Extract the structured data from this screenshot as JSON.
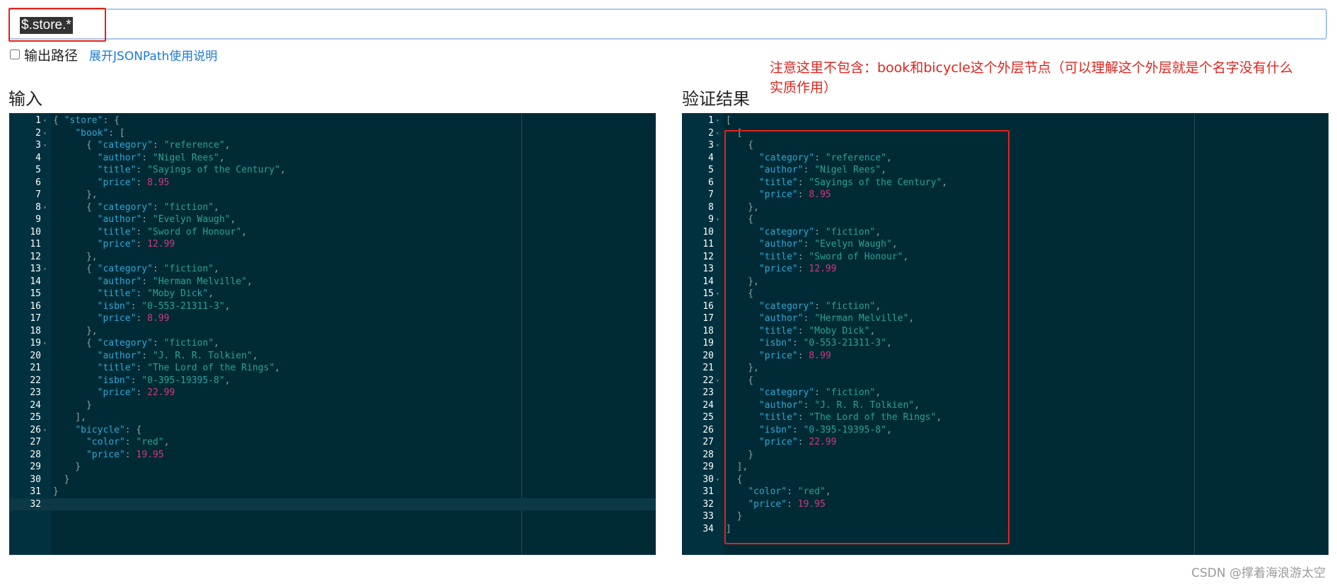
{
  "query": {
    "value": "$.store.*"
  },
  "options": {
    "output_path_label": "输出路径",
    "output_path_checked": false,
    "help_link": "展开JSONPath使用说明"
  },
  "titles": {
    "input": "输入",
    "result": "验证结果"
  },
  "note": "注意这里不包含：book和bicycle这个外层节点（可以理解这个外层就是个名字没有什么实质作用）",
  "watermark": "CSDN @撑着海浪游太空",
  "input_editor": {
    "active_line": 32,
    "lines": [
      {
        "n": "1",
        "fold": true,
        "t": [
          [
            "p",
            "{ "
          ],
          [
            "k",
            "\"store\""
          ],
          [
            "p",
            ": {"
          ]
        ]
      },
      {
        "n": "2",
        "fold": true,
        "t": [
          [
            "p",
            "    "
          ],
          [
            "k",
            "\"book\""
          ],
          [
            "p",
            ": ["
          ]
        ]
      },
      {
        "n": "3",
        "fold": true,
        "t": [
          [
            "p",
            "      { "
          ],
          [
            "k",
            "\"category\""
          ],
          [
            "p",
            ": "
          ],
          [
            "s",
            "\"reference\""
          ],
          [
            "p",
            ","
          ]
        ]
      },
      {
        "n": "4",
        "t": [
          [
            "p",
            "        "
          ],
          [
            "k",
            "\"author\""
          ],
          [
            "p",
            ": "
          ],
          [
            "s",
            "\"Nigel Rees\""
          ],
          [
            "p",
            ","
          ]
        ]
      },
      {
        "n": "5",
        "t": [
          [
            "p",
            "        "
          ],
          [
            "k",
            "\"title\""
          ],
          [
            "p",
            ": "
          ],
          [
            "s",
            "\"Sayings of the Century\""
          ],
          [
            "p",
            ","
          ]
        ]
      },
      {
        "n": "6",
        "t": [
          [
            "p",
            "        "
          ],
          [
            "k",
            "\"price\""
          ],
          [
            "p",
            ": "
          ],
          [
            "n",
            "8.95"
          ]
        ]
      },
      {
        "n": "7",
        "t": [
          [
            "p",
            "      },"
          ]
        ]
      },
      {
        "n": "8",
        "fold": true,
        "t": [
          [
            "p",
            "      { "
          ],
          [
            "k",
            "\"category\""
          ],
          [
            "p",
            ": "
          ],
          [
            "s",
            "\"fiction\""
          ],
          [
            "p",
            ","
          ]
        ]
      },
      {
        "n": "9",
        "t": [
          [
            "p",
            "        "
          ],
          [
            "k",
            "\"author\""
          ],
          [
            "p",
            ": "
          ],
          [
            "s",
            "\"Evelyn Waugh\""
          ],
          [
            "p",
            ","
          ]
        ]
      },
      {
        "n": "10",
        "t": [
          [
            "p",
            "        "
          ],
          [
            "k",
            "\"title\""
          ],
          [
            "p",
            ": "
          ],
          [
            "s",
            "\"Sword of Honour\""
          ],
          [
            "p",
            ","
          ]
        ]
      },
      {
        "n": "11",
        "t": [
          [
            "p",
            "        "
          ],
          [
            "k",
            "\"price\""
          ],
          [
            "p",
            ": "
          ],
          [
            "n",
            "12.99"
          ]
        ]
      },
      {
        "n": "12",
        "t": [
          [
            "p",
            "      },"
          ]
        ]
      },
      {
        "n": "13",
        "fold": true,
        "t": [
          [
            "p",
            "      { "
          ],
          [
            "k",
            "\"category\""
          ],
          [
            "p",
            ": "
          ],
          [
            "s",
            "\"fiction\""
          ],
          [
            "p",
            ","
          ]
        ]
      },
      {
        "n": "14",
        "t": [
          [
            "p",
            "        "
          ],
          [
            "k",
            "\"author\""
          ],
          [
            "p",
            ": "
          ],
          [
            "s",
            "\"Herman Melville\""
          ],
          [
            "p",
            ","
          ]
        ]
      },
      {
        "n": "15",
        "t": [
          [
            "p",
            "        "
          ],
          [
            "k",
            "\"title\""
          ],
          [
            "p",
            ": "
          ],
          [
            "s",
            "\"Moby Dick\""
          ],
          [
            "p",
            ","
          ]
        ]
      },
      {
        "n": "16",
        "t": [
          [
            "p",
            "        "
          ],
          [
            "k",
            "\"isbn\""
          ],
          [
            "p",
            ": "
          ],
          [
            "s",
            "\"0-553-21311-3\""
          ],
          [
            "p",
            ","
          ]
        ]
      },
      {
        "n": "17",
        "t": [
          [
            "p",
            "        "
          ],
          [
            "k",
            "\"price\""
          ],
          [
            "p",
            ": "
          ],
          [
            "n",
            "8.99"
          ]
        ]
      },
      {
        "n": "18",
        "t": [
          [
            "p",
            "      },"
          ]
        ]
      },
      {
        "n": "19",
        "fold": true,
        "t": [
          [
            "p",
            "      { "
          ],
          [
            "k",
            "\"category\""
          ],
          [
            "p",
            ": "
          ],
          [
            "s",
            "\"fiction\""
          ],
          [
            "p",
            ","
          ]
        ]
      },
      {
        "n": "20",
        "t": [
          [
            "p",
            "        "
          ],
          [
            "k",
            "\"author\""
          ],
          [
            "p",
            ": "
          ],
          [
            "s",
            "\"J. R. R. Tolkien\""
          ],
          [
            "p",
            ","
          ]
        ]
      },
      {
        "n": "21",
        "t": [
          [
            "p",
            "        "
          ],
          [
            "k",
            "\"title\""
          ],
          [
            "p",
            ": "
          ],
          [
            "s",
            "\"The Lord of the Rings\""
          ],
          [
            "p",
            ","
          ]
        ]
      },
      {
        "n": "22",
        "t": [
          [
            "p",
            "        "
          ],
          [
            "k",
            "\"isbn\""
          ],
          [
            "p",
            ": "
          ],
          [
            "s",
            "\"0-395-19395-8\""
          ],
          [
            "p",
            ","
          ]
        ]
      },
      {
        "n": "23",
        "t": [
          [
            "p",
            "        "
          ],
          [
            "k",
            "\"price\""
          ],
          [
            "p",
            ": "
          ],
          [
            "n",
            "22.99"
          ]
        ]
      },
      {
        "n": "24",
        "t": [
          [
            "p",
            "      }"
          ]
        ]
      },
      {
        "n": "25",
        "t": [
          [
            "p",
            "    ],"
          ]
        ]
      },
      {
        "n": "26",
        "fold": true,
        "t": [
          [
            "p",
            "    "
          ],
          [
            "k",
            "\"bicycle\""
          ],
          [
            "p",
            ": {"
          ]
        ]
      },
      {
        "n": "27",
        "t": [
          [
            "p",
            "      "
          ],
          [
            "k",
            "\"color\""
          ],
          [
            "p",
            ": "
          ],
          [
            "s",
            "\"red\""
          ],
          [
            "p",
            ","
          ]
        ]
      },
      {
        "n": "28",
        "t": [
          [
            "p",
            "      "
          ],
          [
            "k",
            "\"price\""
          ],
          [
            "p",
            ": "
          ],
          [
            "n",
            "19.95"
          ]
        ]
      },
      {
        "n": "29",
        "t": [
          [
            "p",
            "    }"
          ]
        ]
      },
      {
        "n": "30",
        "t": [
          [
            "p",
            "  }"
          ]
        ]
      },
      {
        "n": "31",
        "t": [
          [
            "p",
            "}"
          ]
        ]
      },
      {
        "n": "32",
        "t": [
          [
            "p",
            ""
          ]
        ]
      }
    ]
  },
  "result_editor": {
    "active_line": 0,
    "lines": [
      {
        "n": "1",
        "fold": true,
        "t": [
          [
            "p",
            "["
          ]
        ]
      },
      {
        "n": "2",
        "fold": true,
        "t": [
          [
            "p",
            "  ["
          ]
        ]
      },
      {
        "n": "3",
        "fold": true,
        "t": [
          [
            "p",
            "    {"
          ]
        ]
      },
      {
        "n": "4",
        "t": [
          [
            "p",
            "      "
          ],
          [
            "k",
            "\"category\""
          ],
          [
            "p",
            ": "
          ],
          [
            "s",
            "\"reference\""
          ],
          [
            "p",
            ","
          ]
        ]
      },
      {
        "n": "5",
        "t": [
          [
            "p",
            "      "
          ],
          [
            "k",
            "\"author\""
          ],
          [
            "p",
            ": "
          ],
          [
            "s",
            "\"Nigel Rees\""
          ],
          [
            "p",
            ","
          ]
        ]
      },
      {
        "n": "6",
        "t": [
          [
            "p",
            "      "
          ],
          [
            "k",
            "\"title\""
          ],
          [
            "p",
            ": "
          ],
          [
            "s",
            "\"Sayings of the Century\""
          ],
          [
            "p",
            ","
          ]
        ]
      },
      {
        "n": "7",
        "t": [
          [
            "p",
            "      "
          ],
          [
            "k",
            "\"price\""
          ],
          [
            "p",
            ": "
          ],
          [
            "n",
            "8.95"
          ]
        ]
      },
      {
        "n": "8",
        "t": [
          [
            "p",
            "    },"
          ]
        ]
      },
      {
        "n": "9",
        "fold": true,
        "t": [
          [
            "p",
            "    {"
          ]
        ]
      },
      {
        "n": "10",
        "t": [
          [
            "p",
            "      "
          ],
          [
            "k",
            "\"category\""
          ],
          [
            "p",
            ": "
          ],
          [
            "s",
            "\"fiction\""
          ],
          [
            "p",
            ","
          ]
        ]
      },
      {
        "n": "11",
        "t": [
          [
            "p",
            "      "
          ],
          [
            "k",
            "\"author\""
          ],
          [
            "p",
            ": "
          ],
          [
            "s",
            "\"Evelyn Waugh\""
          ],
          [
            "p",
            ","
          ]
        ]
      },
      {
        "n": "12",
        "t": [
          [
            "p",
            "      "
          ],
          [
            "k",
            "\"title\""
          ],
          [
            "p",
            ": "
          ],
          [
            "s",
            "\"Sword of Honour\""
          ],
          [
            "p",
            ","
          ]
        ]
      },
      {
        "n": "13",
        "t": [
          [
            "p",
            "      "
          ],
          [
            "k",
            "\"price\""
          ],
          [
            "p",
            ": "
          ],
          [
            "n",
            "12.99"
          ]
        ]
      },
      {
        "n": "14",
        "t": [
          [
            "p",
            "    },"
          ]
        ]
      },
      {
        "n": "15",
        "fold": true,
        "t": [
          [
            "p",
            "    {"
          ]
        ]
      },
      {
        "n": "16",
        "t": [
          [
            "p",
            "      "
          ],
          [
            "k",
            "\"category\""
          ],
          [
            "p",
            ": "
          ],
          [
            "s",
            "\"fiction\""
          ],
          [
            "p",
            ","
          ]
        ]
      },
      {
        "n": "17",
        "t": [
          [
            "p",
            "      "
          ],
          [
            "k",
            "\"author\""
          ],
          [
            "p",
            ": "
          ],
          [
            "s",
            "\"Herman Melville\""
          ],
          [
            "p",
            ","
          ]
        ]
      },
      {
        "n": "18",
        "t": [
          [
            "p",
            "      "
          ],
          [
            "k",
            "\"title\""
          ],
          [
            "p",
            ": "
          ],
          [
            "s",
            "\"Moby Dick\""
          ],
          [
            "p",
            ","
          ]
        ]
      },
      {
        "n": "19",
        "t": [
          [
            "p",
            "      "
          ],
          [
            "k",
            "\"isbn\""
          ],
          [
            "p",
            ": "
          ],
          [
            "s",
            "\"0-553-21311-3\""
          ],
          [
            "p",
            ","
          ]
        ]
      },
      {
        "n": "20",
        "t": [
          [
            "p",
            "      "
          ],
          [
            "k",
            "\"price\""
          ],
          [
            "p",
            ": "
          ],
          [
            "n",
            "8.99"
          ]
        ]
      },
      {
        "n": "21",
        "t": [
          [
            "p",
            "    },"
          ]
        ]
      },
      {
        "n": "22",
        "fold": true,
        "t": [
          [
            "p",
            "    {"
          ]
        ]
      },
      {
        "n": "23",
        "t": [
          [
            "p",
            "      "
          ],
          [
            "k",
            "\"category\""
          ],
          [
            "p",
            ": "
          ],
          [
            "s",
            "\"fiction\""
          ],
          [
            "p",
            ","
          ]
        ]
      },
      {
        "n": "24",
        "t": [
          [
            "p",
            "      "
          ],
          [
            "k",
            "\"author\""
          ],
          [
            "p",
            ": "
          ],
          [
            "s",
            "\"J. R. R. Tolkien\""
          ],
          [
            "p",
            ","
          ]
        ]
      },
      {
        "n": "25",
        "t": [
          [
            "p",
            "      "
          ],
          [
            "k",
            "\"title\""
          ],
          [
            "p",
            ": "
          ],
          [
            "s",
            "\"The Lord of the Rings\""
          ],
          [
            "p",
            ","
          ]
        ]
      },
      {
        "n": "26",
        "t": [
          [
            "p",
            "      "
          ],
          [
            "k",
            "\"isbn\""
          ],
          [
            "p",
            ": "
          ],
          [
            "s",
            "\"0-395-19395-8\""
          ],
          [
            "p",
            ","
          ]
        ]
      },
      {
        "n": "27",
        "t": [
          [
            "p",
            "      "
          ],
          [
            "k",
            "\"price\""
          ],
          [
            "p",
            ": "
          ],
          [
            "n",
            "22.99"
          ]
        ]
      },
      {
        "n": "28",
        "t": [
          [
            "p",
            "    }"
          ]
        ]
      },
      {
        "n": "29",
        "t": [
          [
            "p",
            "  ],"
          ]
        ]
      },
      {
        "n": "30",
        "fold": true,
        "t": [
          [
            "p",
            "  {"
          ]
        ]
      },
      {
        "n": "31",
        "t": [
          [
            "p",
            "    "
          ],
          [
            "k",
            "\"color\""
          ],
          [
            "p",
            ": "
          ],
          [
            "s",
            "\"red\""
          ],
          [
            "p",
            ","
          ]
        ]
      },
      {
        "n": "32",
        "t": [
          [
            "p",
            "    "
          ],
          [
            "k",
            "\"price\""
          ],
          [
            "p",
            ": "
          ],
          [
            "n",
            "19.95"
          ]
        ]
      },
      {
        "n": "33",
        "t": [
          [
            "p",
            "  }"
          ]
        ]
      },
      {
        "n": "34",
        "t": [
          [
            "p",
            "]"
          ]
        ]
      }
    ]
  }
}
